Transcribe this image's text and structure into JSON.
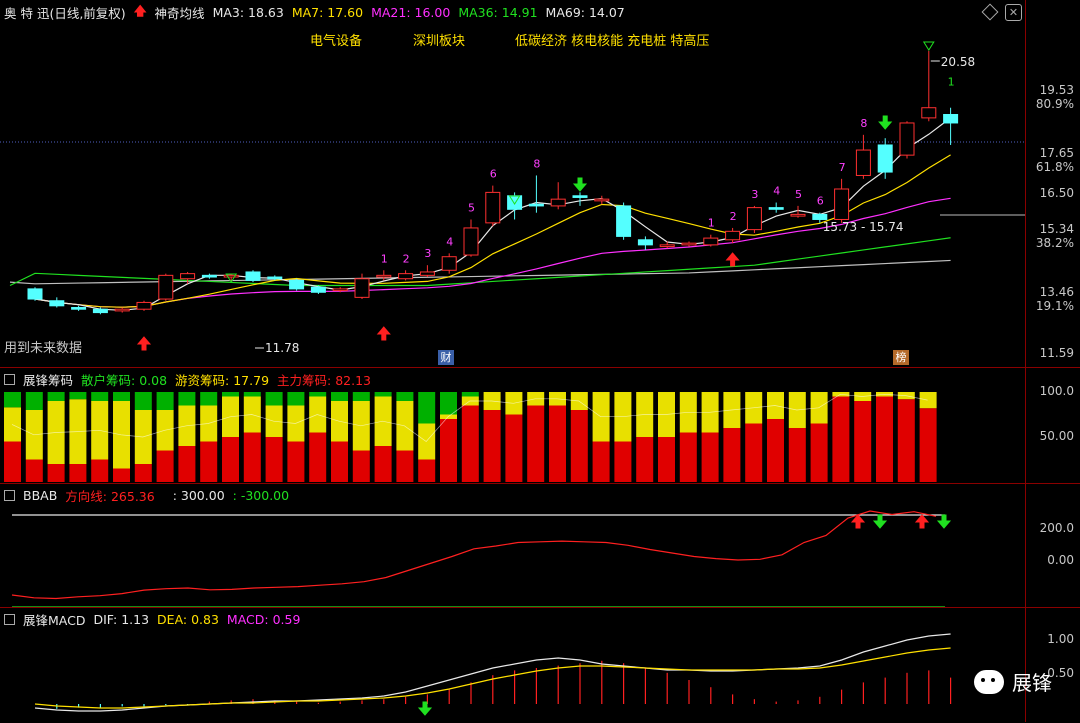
{
  "stock": {
    "name": "奥 特 迅",
    "period": "(日线,前复权)",
    "indicator": "神奇均线",
    "ma": [
      {
        "label": "MA3: 18.63",
        "color": "#e8e8e8"
      },
      {
        "label": "MA7: 17.60",
        "color": "#ffe000"
      },
      {
        "label": "MA21: 16.00",
        "color": "#ff30ff"
      },
      {
        "label": "MA36: 14.91",
        "color": "#20e020"
      },
      {
        "label": "MA69: 14.07",
        "color": "#c0c0c0"
      }
    ],
    "tags": [
      "电气设备",
      "深圳板块",
      "低碳经济 核电核能 充电桩 特高压"
    ]
  },
  "main_chart": {
    "y_labels": [
      "19.53",
      "80.9%",
      "17.65",
      "61.8%",
      "16.50",
      "15.34",
      "38.2%",
      "13.46",
      "19.1%",
      "11.59"
    ],
    "notes": {
      "high": "20.58",
      "low": "11.78",
      "mid": "15.73 - 15.74",
      "future": "用到未来数据",
      "badge_cai": "财",
      "badge_bang": "榜",
      "count_1": "1"
    },
    "counts_left": [
      "1",
      "2",
      "3",
      "4",
      "5",
      "6",
      "8"
    ],
    "counts_right": [
      "1",
      "2",
      "3",
      "4",
      "5",
      "6",
      "7",
      "8"
    ],
    "candles": [
      {
        "o": 13.55,
        "c": 13.25,
        "h": 13.6,
        "l": 13.2
      },
      {
        "o": 13.2,
        "c": 13.05,
        "h": 13.3,
        "l": 13.0
      },
      {
        "o": 13.0,
        "c": 12.95,
        "h": 13.05,
        "l": 12.9
      },
      {
        "o": 12.95,
        "c": 12.85,
        "h": 13.0,
        "l": 12.8
      },
      {
        "o": 12.9,
        "c": 12.95,
        "h": 13.0,
        "l": 12.85
      },
      {
        "o": 12.95,
        "c": 13.15,
        "h": 13.2,
        "l": 12.9
      },
      {
        "o": 13.25,
        "c": 13.95,
        "h": 14.0,
        "l": 13.2
      },
      {
        "o": 13.85,
        "c": 14.0,
        "h": 14.05,
        "l": 13.7
      },
      {
        "o": 13.95,
        "c": 13.9,
        "h": 14.0,
        "l": 13.85
      },
      {
        "o": 13.9,
        "c": 13.95,
        "h": 14.0,
        "l": 13.8
      },
      {
        "o": 14.05,
        "c": 13.8,
        "h": 14.1,
        "l": 13.75
      },
      {
        "o": 13.9,
        "c": 13.85,
        "h": 13.95,
        "l": 13.8
      },
      {
        "o": 13.8,
        "c": 13.55,
        "h": 13.85,
        "l": 13.5
      },
      {
        "o": 13.6,
        "c": 13.45,
        "h": 13.65,
        "l": 13.4
      },
      {
        "o": 13.5,
        "c": 13.55,
        "h": 13.6,
        "l": 13.45
      },
      {
        "o": 13.3,
        "c": 13.85,
        "h": 14.0,
        "l": 13.25
      },
      {
        "o": 13.9,
        "c": 13.95,
        "h": 14.1,
        "l": 13.8
      },
      {
        "o": 13.85,
        "c": 14.0,
        "h": 14.1,
        "l": 13.8
      },
      {
        "o": 13.95,
        "c": 14.05,
        "h": 14.25,
        "l": 13.9
      },
      {
        "o": 14.1,
        "c": 14.5,
        "h": 14.6,
        "l": 14.0
      },
      {
        "o": 14.55,
        "c": 15.35,
        "h": 15.6,
        "l": 14.5
      },
      {
        "o": 15.5,
        "c": 16.4,
        "h": 16.6,
        "l": 15.4
      },
      {
        "o": 16.3,
        "c": 15.9,
        "h": 16.4,
        "l": 15.6
      },
      {
        "o": 16.05,
        "c": 16.0,
        "h": 16.9,
        "l": 15.8
      },
      {
        "o": 16.0,
        "c": 16.2,
        "h": 16.7,
        "l": 15.9
      },
      {
        "o": 16.3,
        "c": 16.25,
        "h": 16.4,
        "l": 16.0
      },
      {
        "o": 16.15,
        "c": 16.2,
        "h": 16.3,
        "l": 16.05
      },
      {
        "o": 16.0,
        "c": 15.1,
        "h": 16.1,
        "l": 15.0
      },
      {
        "o": 15.0,
        "c": 14.85,
        "h": 15.1,
        "l": 14.7
      },
      {
        "o": 14.8,
        "c": 14.85,
        "h": 14.95,
        "l": 14.75
      },
      {
        "o": 14.85,
        "c": 14.9,
        "h": 14.95,
        "l": 14.8
      },
      {
        "o": 14.85,
        "c": 15.05,
        "h": 15.15,
        "l": 14.8
      },
      {
        "o": 15.0,
        "c": 15.25,
        "h": 15.35,
        "l": 14.9
      },
      {
        "o": 15.3,
        "c": 15.95,
        "h": 16.0,
        "l": 15.2
      },
      {
        "o": 15.95,
        "c": 15.9,
        "h": 16.1,
        "l": 15.8
      },
      {
        "o": 15.7,
        "c": 15.75,
        "h": 16.0,
        "l": 15.65
      },
      {
        "o": 15.75,
        "c": 15.6,
        "h": 15.8,
        "l": 15.5
      },
      {
        "o": 15.6,
        "c": 16.5,
        "h": 16.8,
        "l": 15.5
      },
      {
        "o": 16.9,
        "c": 17.65,
        "h": 18.1,
        "l": 16.8
      },
      {
        "o": 17.8,
        "c": 17.0,
        "h": 18.0,
        "l": 16.8
      },
      {
        "o": 17.5,
        "c": 18.45,
        "h": 18.5,
        "l": 17.4
      },
      {
        "o": 18.6,
        "c": 18.9,
        "h": 20.58,
        "l": 18.5
      },
      {
        "o": 18.7,
        "c": 18.45,
        "h": 18.9,
        "l": 17.8
      }
    ]
  },
  "chip_panel": {
    "title": "展锋筹码",
    "retail": "散户筹码: 0.08",
    "hot": "游资筹码: 17.79",
    "main": "主力筹码: 82.13",
    "y_labels": [
      "100.0",
      "50.00"
    ],
    "values": [
      [
        0.45,
        0.38,
        0.17
      ],
      [
        0.25,
        0.55,
        0.2
      ],
      [
        0.2,
        0.7,
        0.1
      ],
      [
        0.2,
        0.72,
        0.08
      ],
      [
        0.25,
        0.65,
        0.1
      ],
      [
        0.15,
        0.75,
        0.1
      ],
      [
        0.2,
        0.6,
        0.2
      ],
      [
        0.35,
        0.45,
        0.2
      ],
      [
        0.4,
        0.45,
        0.15
      ],
      [
        0.45,
        0.4,
        0.15
      ],
      [
        0.5,
        0.45,
        0.05
      ],
      [
        0.55,
        0.4,
        0.05
      ],
      [
        0.5,
        0.35,
        0.15
      ],
      [
        0.45,
        0.4,
        0.15
      ],
      [
        0.55,
        0.4,
        0.05
      ],
      [
        0.45,
        0.45,
        0.1
      ],
      [
        0.35,
        0.55,
        0.1
      ],
      [
        0.4,
        0.55,
        0.05
      ],
      [
        0.35,
        0.55,
        0.1
      ],
      [
        0.25,
        0.4,
        0.35
      ],
      [
        0.7,
        0.05,
        0.25
      ],
      [
        0.85,
        0.1,
        0.05
      ],
      [
        0.8,
        0.2,
        0.0
      ],
      [
        0.75,
        0.25,
        0.0
      ],
      [
        0.85,
        0.15,
        0.0
      ],
      [
        0.85,
        0.15,
        0.0
      ],
      [
        0.8,
        0.2,
        0.0
      ],
      [
        0.45,
        0.55,
        0.0
      ],
      [
        0.45,
        0.55,
        0.0
      ],
      [
        0.5,
        0.5,
        0.0
      ],
      [
        0.5,
        0.5,
        0.0
      ],
      [
        0.55,
        0.45,
        0.0
      ],
      [
        0.55,
        0.45,
        0.0
      ],
      [
        0.6,
        0.4,
        0.0
      ],
      [
        0.65,
        0.35,
        0.0
      ],
      [
        0.7,
        0.3,
        0.0
      ],
      [
        0.6,
        0.4,
        0.0
      ],
      [
        0.65,
        0.35,
        0.0
      ],
      [
        0.95,
        0.05,
        0.0
      ],
      [
        0.9,
        0.1,
        0.0
      ],
      [
        0.95,
        0.05,
        0.0
      ],
      [
        0.92,
        0.08,
        0.0
      ],
      [
        0.82,
        0.18,
        0.0
      ]
    ]
  },
  "bbab_panel": {
    "title": "BBAB",
    "dir": "方向线: 265.36",
    "v1": ": 300.00",
    "v2": ": -300.00",
    "y_labels": [
      "200.0",
      "0.00"
    ]
  },
  "macd_panel": {
    "title": "展锋MACD",
    "dif": "DIF: 1.13",
    "dea": "DEA: 0.83",
    "macd": "MACD: 0.59",
    "y_labels": [
      "1.00",
      "0.50"
    ]
  },
  "watermark": {
    "text": "展锋"
  }
}
